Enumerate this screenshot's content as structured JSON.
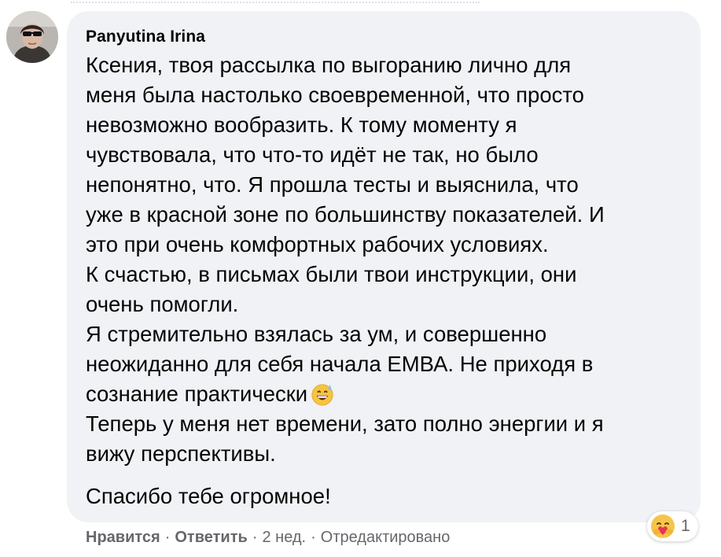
{
  "comment": {
    "author": "Panyutina Irina",
    "lines": [
      "Ксения, твоя рассылка по выгоранию лично для",
      "меня была настолько своевременной, что просто",
      "невозможно вообразить. К тому моменту я",
      "чувствовала, что что-то идёт не так, но было",
      "непонятно, что. Я прошла тесты и выяснила, что",
      "уже в красной зоне по большинству показателей. И",
      "это при очень комфортных рабочих условиях.",
      "К счастью, в письмах были твои инструкции, они",
      "очень помогли.",
      "Я стремительно взялась за ум, и совершенно",
      "неожиданно для себя начала ЕМВА. Не приходя в",
      "сознание практически",
      "Теперь у меня нет времени, зато полно энергии и я",
      "вижу перспективы.",
      "Спасибо тебе огромное!"
    ],
    "inline_emoji": "grinning-face-with-sweat-icon",
    "reaction_emoji": "care-hug-icon",
    "reaction_count": "1"
  },
  "actions": {
    "like": "Нравится",
    "reply": "Ответить",
    "separator": "·",
    "time": "2 нед.",
    "edited": "Отредактировано"
  },
  "colors": {
    "bubble": "#f0f2f5",
    "text": "#050505",
    "secondary": "#65676b"
  }
}
